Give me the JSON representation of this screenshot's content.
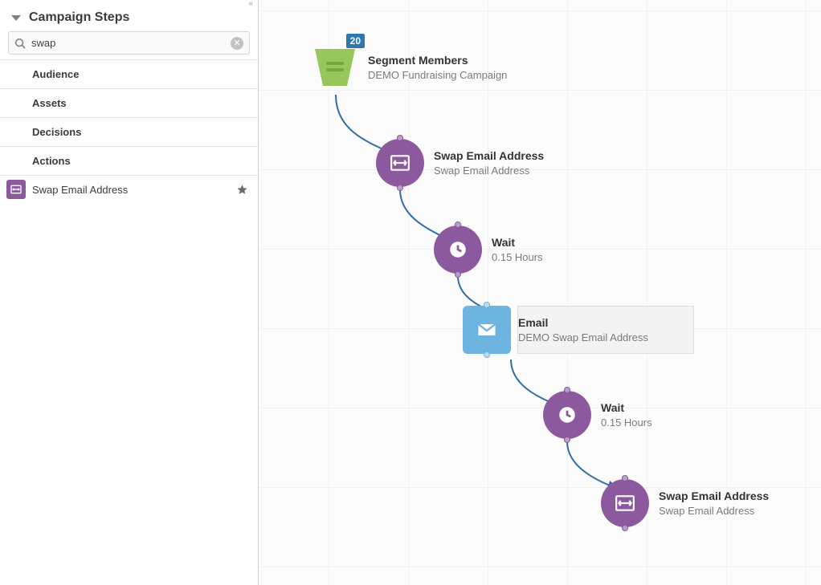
{
  "sidebar": {
    "heading": "Campaign Steps",
    "search_value": "swap",
    "search_placeholder": "",
    "categories": [
      {
        "label": "Audience"
      },
      {
        "label": "Assets"
      },
      {
        "label": "Decisions"
      },
      {
        "label": "Actions"
      }
    ],
    "step": {
      "label": "Swap Email Address",
      "icon": "swap-icon"
    }
  },
  "canvas": {
    "segment": {
      "title": "Segment Members",
      "sub": "DEMO Fundraising Campaign",
      "badge": "20"
    },
    "nodes": [
      {
        "id": "swap1",
        "title": "Swap Email Address",
        "sub": "Swap Email Address"
      },
      {
        "id": "wait1",
        "title": "Wait",
        "sub": "0.15 Hours"
      },
      {
        "id": "email",
        "title": "Email",
        "sub": "DEMO Swap Email Address"
      },
      {
        "id": "wait2",
        "title": "Wait",
        "sub": "0.15 Hours"
      },
      {
        "id": "swap2",
        "title": "Swap Email Address",
        "sub": "Swap Email Address"
      }
    ]
  }
}
